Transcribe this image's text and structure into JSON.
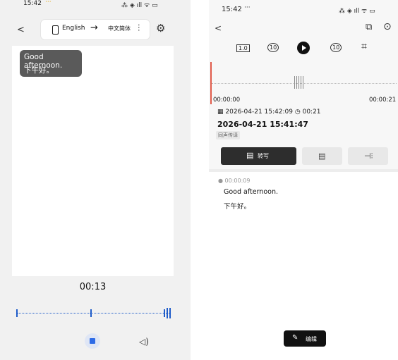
{
  "left": {
    "status_time": "15:42",
    "status_extra": "···",
    "status_right": "⁂ ◈ ıll ᯤ ▭",
    "back_icon": "chevron-left-icon",
    "source_lang": "English",
    "target_lang": "中文简体",
    "message": {
      "en": "Good afternoon.",
      "zh": "下午好。"
    },
    "timer": "00:13"
  },
  "right": {
    "status_time": "15:42",
    "status_extra": "···",
    "status_right": "⁂ ◈ ıll ᯤ ▭",
    "controls": {
      "speed": "1.0",
      "back": "10",
      "forward": "10"
    },
    "waveform": {
      "start": "00:00:00",
      "end": "00:00:21"
    },
    "recording": {
      "date": "2026-04-21 15:42:09",
      "duration": "00:21",
      "title": "2026-04-21 15:41:47",
      "tag": "同声传译"
    },
    "tabs": {
      "transcribe": "转写"
    },
    "segment": {
      "time": "00:00:09",
      "en": "Good afternoon.",
      "zh": "下午好。"
    },
    "edit_label": "编辑"
  },
  "colors": {
    "accent_blue": "#2e6be6",
    "playhead": "#e05a4a",
    "dark": "#2d2d2d"
  }
}
